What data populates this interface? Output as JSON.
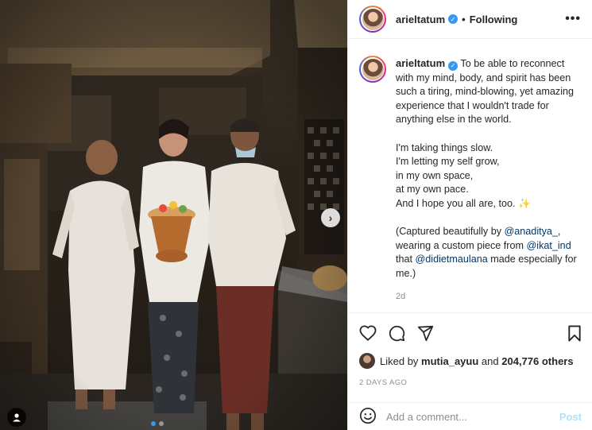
{
  "post": {
    "username": "arieltatum",
    "separator": "•",
    "follow_status": "Following",
    "more_label": "•••",
    "caption": {
      "intro": "To be able to reconnect with my mind, body, and spirit has been such a tiring, mind-blowing, yet amazing experience that I wouldn't trade for anything else in the world.",
      "line1": "I'm taking things slow.",
      "line2": "I'm letting my self grow,",
      "line3": "in my own space,",
      "line4": "at my own pace.",
      "line5": "And I hope you all are, too.",
      "sparkle": "✨",
      "credit_prefix": "(Captured beautifully by ",
      "credit_user1": "@anaditya_",
      "credit_mid1": ", wearing a custom piece from ",
      "credit_user2": "@ikat_ind",
      "credit_mid2": " that ",
      "credit_user3": "@didietmaulana",
      "credit_suffix": " made especially for me.)"
    },
    "age": "2d",
    "likes": {
      "prefix": "Liked by",
      "liker": "mutia_ayuu",
      "and": "and",
      "others": "204,776 others"
    },
    "posted": "2 DAYS AGO",
    "comment_placeholder": "Add a comment...",
    "post_label": "Post"
  },
  "carousel": {
    "next_icon": "chevron-right-icon",
    "dots": 2,
    "active_dot": 1
  },
  "colors": {
    "link": "#00376b",
    "accent": "#3897f0",
    "post_disabled": "#b2dffc"
  }
}
